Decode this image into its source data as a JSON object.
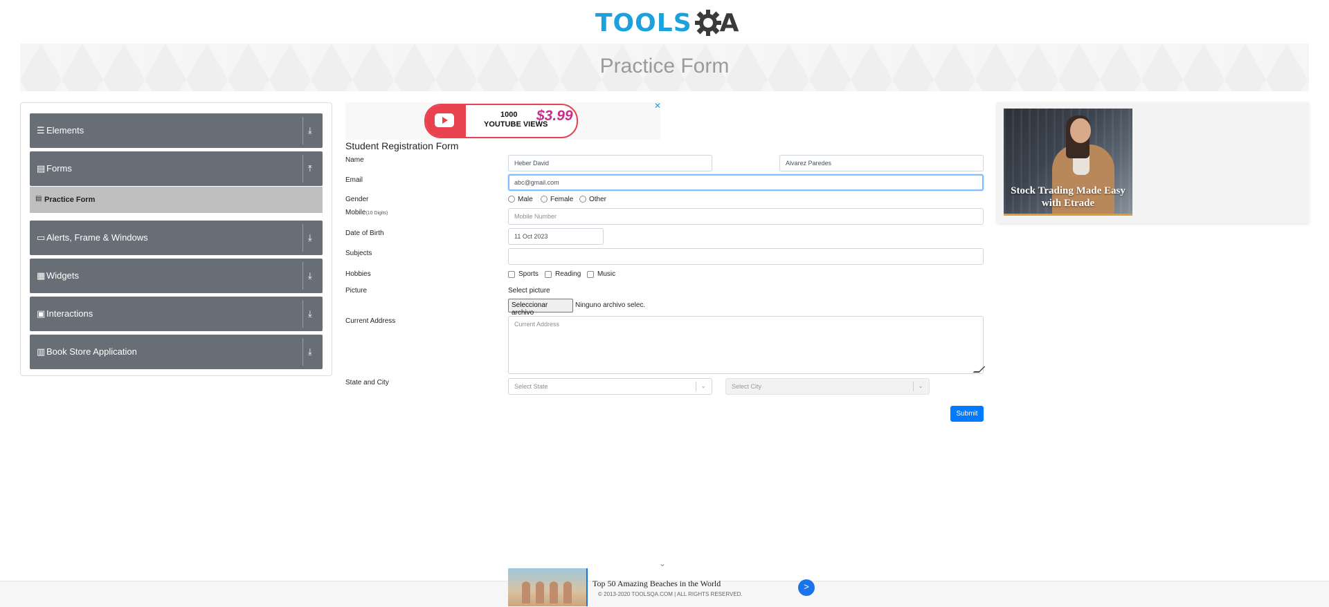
{
  "header": {
    "logo_tools": "TOOLS",
    "logo_a": "A",
    "page_title": "Practice Form"
  },
  "sidebar": {
    "groups": [
      {
        "label": "Elements",
        "icon": "hamburger-icon",
        "arrow": "download-arrow-icon"
      },
      {
        "label": "Forms",
        "icon": "form-icon",
        "arrow": "upload-arrow-icon",
        "expanded": true
      },
      {
        "label": "Alerts, Frame & Windows",
        "icon": "window-icon",
        "arrow": "download-arrow-icon"
      },
      {
        "label": "Widgets",
        "icon": "widgets-icon",
        "arrow": "download-arrow-icon"
      },
      {
        "label": "Interactions",
        "icon": "interactions-icon",
        "arrow": "download-arrow-icon"
      },
      {
        "label": "Book Store Application",
        "icon": "bookstore-icon",
        "arrow": "download-arrow-icon"
      }
    ],
    "active_item": "Practice Form"
  },
  "top_ad": {
    "line1": "1000",
    "line2": "YOUTUBE VIEWS",
    "price": "$3.99",
    "close": "✕"
  },
  "form": {
    "title": "Student Registration Form",
    "labels": {
      "name": "Name",
      "email": "Email",
      "gender": "Gender",
      "mobile": "Mobile",
      "mobile_hint": "(10 Digits)",
      "dob": "Date of Birth",
      "subjects": "Subjects",
      "hobbies": "Hobbies",
      "picture": "Picture",
      "address": "Current Address",
      "state_city": "State and City"
    },
    "first_name": "Heber David",
    "last_name": "Alvarez Paredes",
    "email": "abc@gmail.com",
    "gender_options": [
      "Male",
      "Female",
      "Other"
    ],
    "mobile_placeholder": "Mobile Number",
    "dob": "11 Oct 2023",
    "subjects": "",
    "hobby_options": [
      "Sports",
      "Reading",
      "Music"
    ],
    "picture_label": "Select picture",
    "file_button": "Seleccionar archivo",
    "file_status": "Ninguno archivo selec.",
    "address_placeholder": "Current Address",
    "state_placeholder": "Select State",
    "city_placeholder": "Select City",
    "submit": "Submit"
  },
  "right_ad": {
    "caption": "Stock Trading Made Easy with Etrade"
  },
  "footer": {
    "copyright": "© 2013-2020 TOOLSQA.COM | ALL RIGHTS RESERVED.",
    "ad_text": "Top 50 Amazing Beaches in the World",
    "ad_go": ">"
  },
  "colors": {
    "brand_blue": "#1ba1dd",
    "sidebar_group": "#686e75",
    "active_item": "#bfbfbf",
    "primary": "#007bff",
    "focus_border": "#80bdff"
  }
}
